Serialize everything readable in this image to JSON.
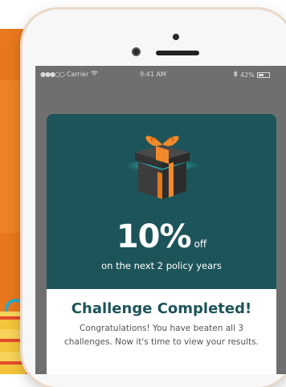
{
  "status_bar": {
    "signal": "●●●○○",
    "carrier": "Carrier",
    "time": "9:41 AM",
    "battery_percent": "42%"
  },
  "reward": {
    "value": "10%",
    "unit": "off",
    "subtitle": "on the next 2 policy years"
  },
  "result": {
    "title": "Challenge Completed!",
    "message": "Congratulations! You have beaten all 3 challenges. Now it's time to view your results."
  },
  "colors": {
    "background": "#e8781d",
    "card": "#1d5459",
    "gift_box": "#3a3a3a",
    "gift_ribbon": "#f08a2c",
    "glow": "#2ee6e6"
  },
  "icons": {
    "gift": "gift-icon",
    "wifi": "wifi-icon",
    "bluetooth": "bluetooth-icon",
    "battery": "battery-icon"
  }
}
